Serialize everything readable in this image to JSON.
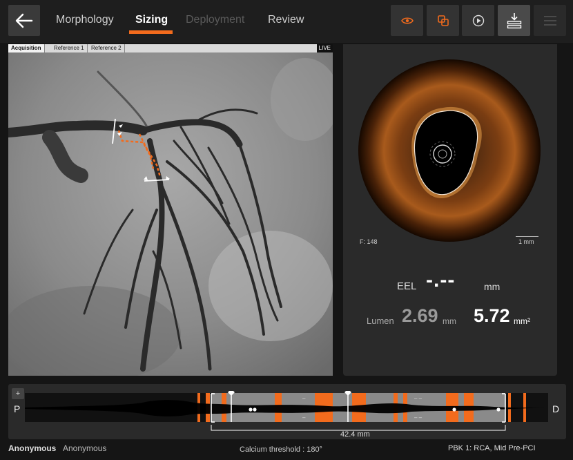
{
  "tabs": [
    {
      "label": "Morphology",
      "state": "normal"
    },
    {
      "label": "Sizing",
      "state": "active"
    },
    {
      "label": "Deployment",
      "state": "disabled"
    },
    {
      "label": "Review",
      "state": "normal"
    }
  ],
  "toolbar": {
    "icons": [
      "eye-icon",
      "overlap-icon",
      "play-icon",
      "download-icon",
      "menu-icon"
    ]
  },
  "angio": {
    "tabs": [
      "Acquisition",
      "Reference 1",
      "Reference 2"
    ],
    "live_label": "LIVE"
  },
  "oct": {
    "frame_label": "F: 148",
    "scale_label": "1 mm",
    "eel_label": "EEL",
    "eel_value": "-.--",
    "eel_unit": "mm",
    "lumen_label": "Lumen",
    "lumen_diameter": "2.69",
    "lumen_diameter_unit": "mm",
    "lumen_area": "5.72",
    "lumen_area_unit": "mm²"
  },
  "longitudinal": {
    "plus_label": "+",
    "proximal_label": "P",
    "distal_label": "D",
    "length_label": "42.4  mm",
    "inner_marks": [
      "–",
      "–",
      "– –",
      "– –"
    ]
  },
  "footer": {
    "patient_name": "Anonymous",
    "patient_id": "Anonymous",
    "calcium_threshold": "Calcium threshold : 180°",
    "case_info": "PBK 1:  RCA,  Mid  Pre-PCI"
  },
  "colors": {
    "accent": "#f26b1d",
    "background": "#151515",
    "panel": "#2a2a2a"
  }
}
